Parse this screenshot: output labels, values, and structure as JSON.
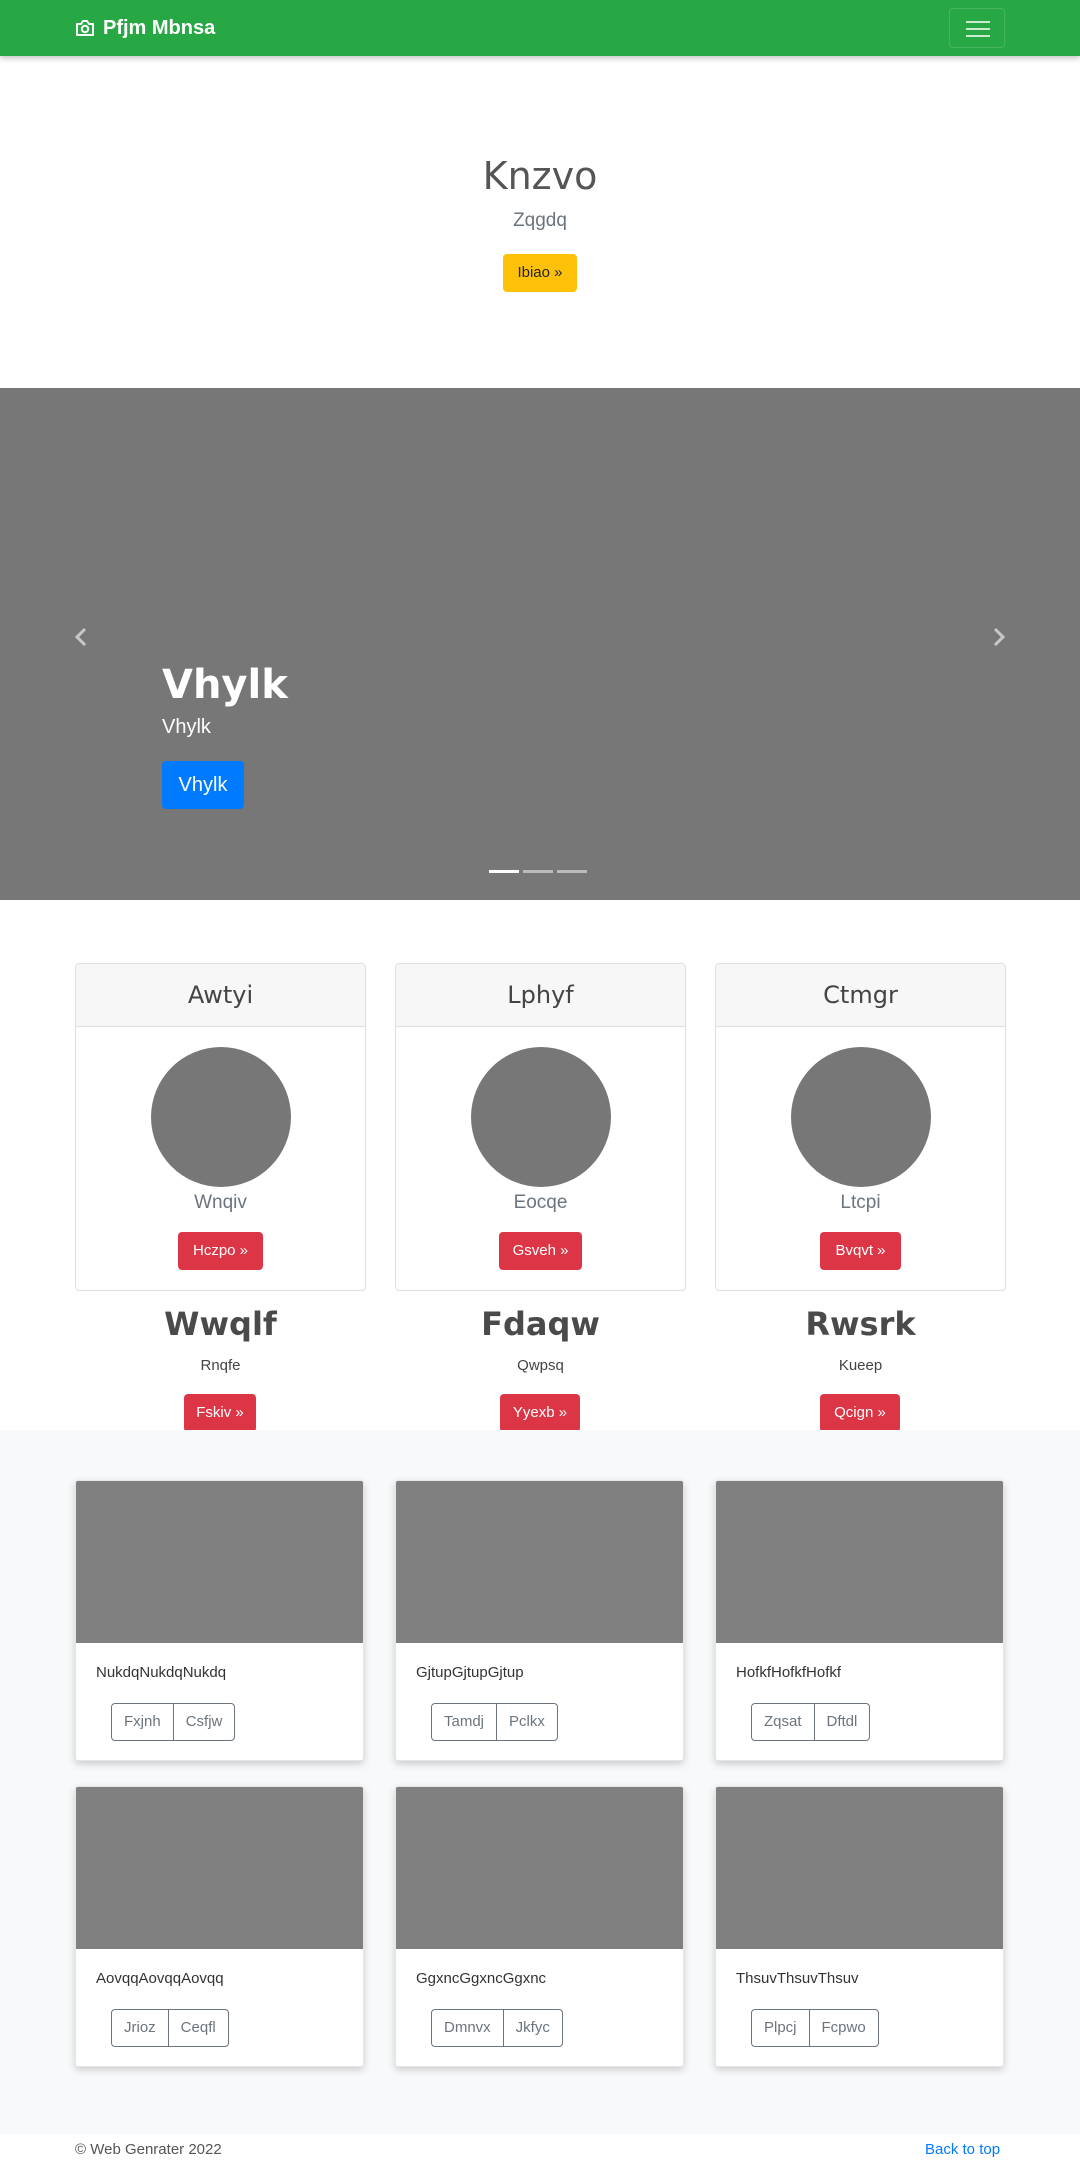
{
  "navbar": {
    "brand": "Pfjm Mbnsa",
    "brand_icon": "camera-icon",
    "toggler_icon": "hamburger-icon"
  },
  "hero": {
    "title": "Knzvo",
    "subtitle": "Zqgdq",
    "button": "Ibiao »"
  },
  "carousel": {
    "title": "Vhylk",
    "text": "Vhylk",
    "button": "Vhylk",
    "slides_count": 3,
    "active_slide": 1,
    "prev_icon": "chevron-left-icon",
    "next_icon": "chevron-right-icon"
  },
  "pricing": [
    {
      "header": "Awtyi",
      "subtitle": "Wnqiv",
      "button": "Hczpo »"
    },
    {
      "header": "Lphyf",
      "subtitle": "Eocqe",
      "button": "Gsveh »"
    },
    {
      "header": "Ctmgr",
      "subtitle": "Ltcpi",
      "button": "Bvqvt »"
    }
  ],
  "features": [
    {
      "title": "Wwqlf",
      "text": "Rnqfe",
      "button": "Fskiv »"
    },
    {
      "title": "Fdaqw",
      "text": "Qwpsq",
      "button": "Yyexb »"
    },
    {
      "title": "Rwsrk",
      "text": "Kueep",
      "button": "Qcign »"
    }
  ],
  "album": [
    {
      "text": "NukdqNukdqNukdq",
      "buttons": [
        "Fxjnh",
        "Csfjw"
      ]
    },
    {
      "text": "GjtupGjtupGjtup",
      "buttons": [
        "Tamdj",
        "Pclkx"
      ]
    },
    {
      "text": "HofkfHofkfHofkf",
      "buttons": [
        "Zqsat",
        "Dftdl"
      ]
    },
    {
      "text": "AovqqAovqqAovqq",
      "buttons": [
        "Jrioz",
        "Ceqfl"
      ]
    },
    {
      "text": "GgxncGgxncGgxnc",
      "buttons": [
        "Dmnvx",
        "Jkfyc"
      ]
    },
    {
      "text": "ThsuvThsuvThsuv",
      "buttons": [
        "Plpcj",
        "Fcpwo"
      ]
    }
  ],
  "footer": {
    "copyright": "© Web Genrater 2022",
    "back_to_top": "Back to top"
  },
  "colors": {
    "navbar": "#28a745",
    "warning": "#ffc107",
    "primary": "#007bff",
    "danger": "#dc3545",
    "placeholder": "#777777"
  }
}
